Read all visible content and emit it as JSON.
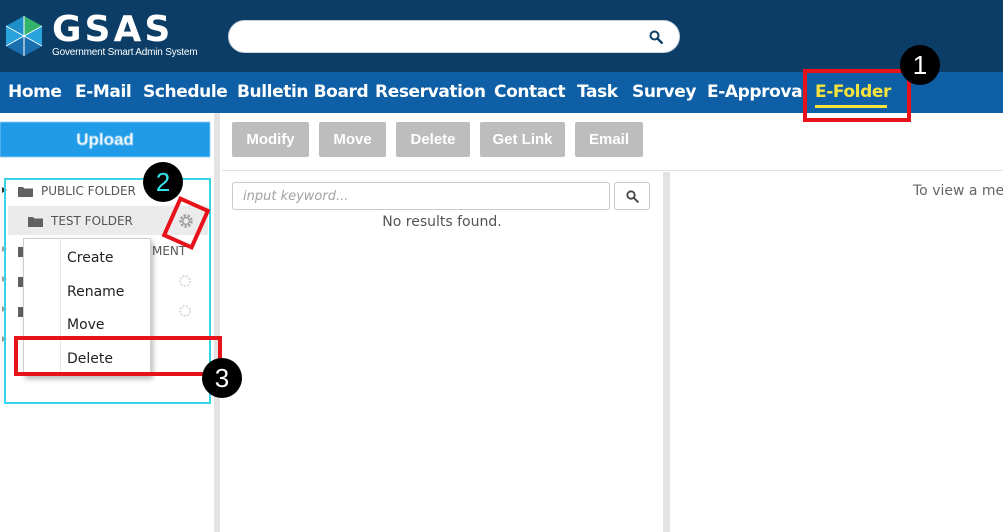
{
  "app": {
    "logo_text": "GSAS",
    "logo_subtitle": "Government Smart Admin System",
    "search_value": ""
  },
  "nav": {
    "items": [
      {
        "label": "Home"
      },
      {
        "label": "E-Mail"
      },
      {
        "label": "Schedule"
      },
      {
        "label": "Bulletin Board"
      },
      {
        "label": "Reservation"
      },
      {
        "label": "Contact"
      },
      {
        "label": "Task"
      },
      {
        "label": "Survey"
      },
      {
        "label": "E-Approval"
      },
      {
        "label": "E-Folder"
      }
    ],
    "active": "E-Folder"
  },
  "sidebar": {
    "upload_label": "Upload",
    "tree": {
      "public_folder": "PUBLIC FOLDER",
      "test_folder": "TEST FOLDER",
      "partial_item_suffix": "MENT"
    },
    "context_menu": [
      {
        "label": "Create"
      },
      {
        "label": "Rename"
      },
      {
        "label": "Move"
      },
      {
        "label": "Delete"
      }
    ]
  },
  "toolbar": {
    "buttons": [
      {
        "label": "Modify"
      },
      {
        "label": "Move"
      },
      {
        "label": "Delete"
      },
      {
        "label": "Get Link"
      },
      {
        "label": "Email"
      }
    ]
  },
  "list": {
    "search_placeholder": "input keyword...",
    "empty_message": "No results found."
  },
  "preview": {
    "message": "To view a mes"
  },
  "annotations": {
    "step1": "1",
    "step2": "2",
    "step3": "3"
  },
  "colors": {
    "header_bg": "#0b3d66",
    "nav_bg": "#0e5fa6",
    "active_nav": "#f5e23b",
    "upload_bg": "#1f9be8",
    "toolbar_btn": "#bdbdbd",
    "annotation_red": "#e8131a",
    "annotation_cyan": "#36d6e7"
  }
}
